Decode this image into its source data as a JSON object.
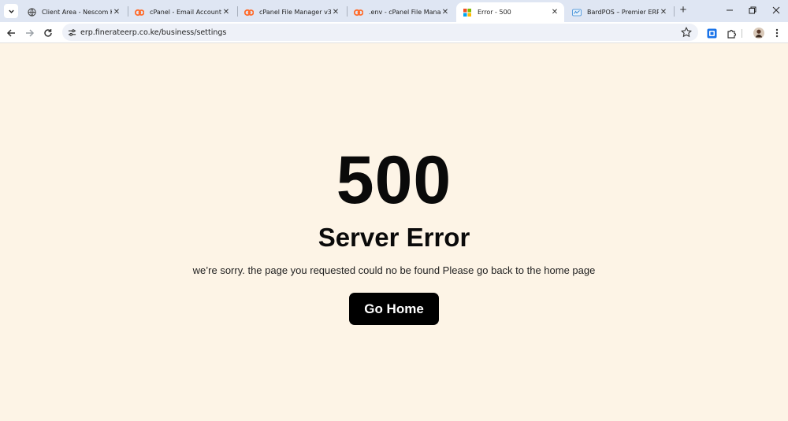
{
  "browser": {
    "tabs": [
      {
        "title": "Client Area - Nescom Kenya",
        "favicon": "globe-icon",
        "active": false
      },
      {
        "title": "cPanel - Email Accounts",
        "favicon": "cpanel-icon",
        "active": false
      },
      {
        "title": "cPanel File Manager v3",
        "favicon": "cpanel-icon",
        "active": false
      },
      {
        "title": ".env - cPanel File Manager",
        "favicon": "cpanel-icon",
        "active": false
      },
      {
        "title": "Error - 500",
        "favicon": "windows-logo-icon",
        "active": true
      },
      {
        "title": "BardPOS – Premier ERP Sol",
        "favicon": "erp-icon",
        "active": false
      }
    ],
    "new_tab_label": "+",
    "close_glyph": "✕",
    "address": "erp.finerateerp.co.ke/business/settings"
  },
  "page": {
    "code": "500",
    "title": "Server Error",
    "message": "we’re sorry. the page you requested could no be found Please go back to the home page",
    "button_label": "Go Home"
  },
  "colors": {
    "page_background": "#fdf4e6",
    "tabstrip": "#dfe6f3",
    "button_background": "#000000",
    "button_text": "#ffffff",
    "cpanel_orange": "#ff6c2c"
  }
}
